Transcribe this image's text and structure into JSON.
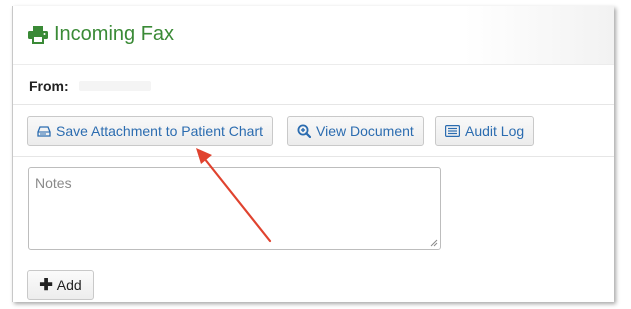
{
  "header": {
    "title": "Incoming Fax",
    "icon": "printer-icon",
    "title_color": "#3a8a36"
  },
  "from": {
    "label": "From:",
    "value": ""
  },
  "actions": {
    "save_attachment_label": "Save Attachment to Patient Chart",
    "save_attachment_icon": "hdd-icon",
    "view_document_label": "View Document",
    "view_document_icon": "zoom-in-icon",
    "audit_log_label": "Audit Log",
    "audit_log_icon": "list-alt-icon",
    "link_color": "#2b6cb0"
  },
  "notes": {
    "placeholder": "Notes",
    "value": ""
  },
  "add_button": {
    "label": "Add",
    "icon": "plus-icon"
  },
  "annotation": {
    "arrow_color": "#e0432f",
    "target": "save-attachment-button"
  }
}
